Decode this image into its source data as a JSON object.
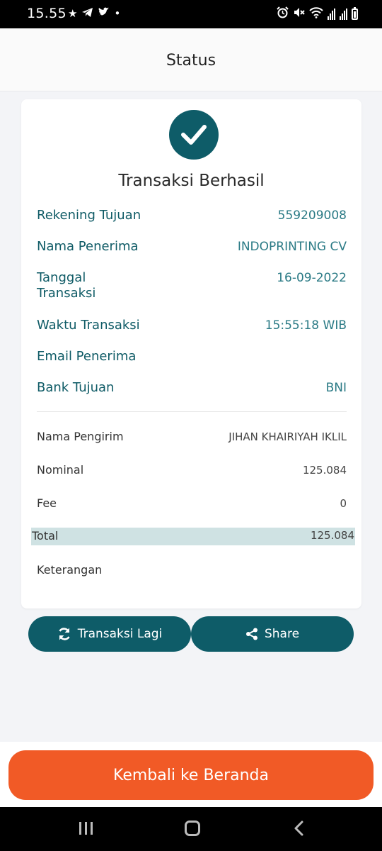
{
  "status_bar": {
    "time": "15.55",
    "left_icons": [
      "notification-icon",
      "telegram-icon",
      "twitter-icon",
      "dot-icon"
    ],
    "right_icons": [
      "alarm-icon",
      "mute-icon",
      "wifi-icon",
      "signal-icon",
      "signal-icon",
      "battery-icon"
    ]
  },
  "header": {
    "title": "Status"
  },
  "card": {
    "title": "Transaksi Berhasil",
    "details": [
      {
        "label": "Rekening Tujuan",
        "value": "559209008"
      },
      {
        "label": "Nama Penerima",
        "value": "INDOPRINTING CV"
      },
      {
        "label": "Tanggal Transaksi",
        "value": "16-09-2022"
      },
      {
        "label": "Waktu Transaksi",
        "value": "15:55:18 WIB"
      },
      {
        "label": "Email Penerima",
        "value": ""
      },
      {
        "label": "Bank Tujuan",
        "value": "BNI"
      }
    ],
    "summary": [
      {
        "label": "Nama Pengirim",
        "value": "JIHAN KHAIRIYAH IKLIL"
      },
      {
        "label": "Nominal",
        "value": "125.084"
      },
      {
        "label": "Fee",
        "value": "0"
      }
    ],
    "total": {
      "label": "Total",
      "value": "125.084"
    },
    "note_label": "Keterangan"
  },
  "actions": {
    "retry_label": "Transaksi Lagi",
    "share_label": "Share"
  },
  "cta": {
    "label": "Kembali ke Beranda"
  },
  "colors": {
    "primary_teal": "#0e5c68",
    "accent_orange": "#f15a26",
    "total_highlight": "#cfe2e3"
  }
}
